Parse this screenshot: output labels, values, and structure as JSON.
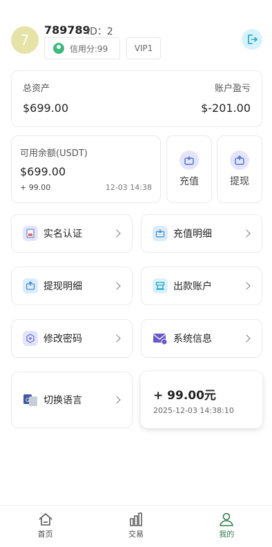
{
  "user": {
    "avatar_letter": "7",
    "username": "789789",
    "id_text": "ID：2",
    "credit_text": "信用分:99",
    "vip_label": "VIP1"
  },
  "assets": {
    "total_label": "总资产",
    "total_value": "$699.00",
    "pnl_label": "账户盈亏",
    "pnl_value": "$-201.00"
  },
  "balance": {
    "label": "可用余额(USDT)",
    "value": "$699.00",
    "change": "+ 99.00",
    "time": "12-03 14:38"
  },
  "actions": {
    "recharge": "充值",
    "withdraw": "提现"
  },
  "menu": {
    "real_name": "实名认证",
    "recharge_detail": "充值明细",
    "withdraw_detail": "提现明细",
    "payout_account": "出款账户",
    "change_password": "修改密码",
    "system_info": "系统信息",
    "switch_language": "切换语言"
  },
  "toast": {
    "amount": "+ 99.00元",
    "time": "2025-12-03 14:38:10"
  },
  "tabs": [
    {
      "label": "首页",
      "icon": "home-icon"
    },
    {
      "label": "交易",
      "icon": "chart-icon"
    },
    {
      "label": "我的",
      "icon": "user-icon"
    }
  ],
  "colors": {
    "accent": "#2e7d4f",
    "logout_bg": "#d8f2fb",
    "avatar_bg": "#e6e3a6"
  }
}
